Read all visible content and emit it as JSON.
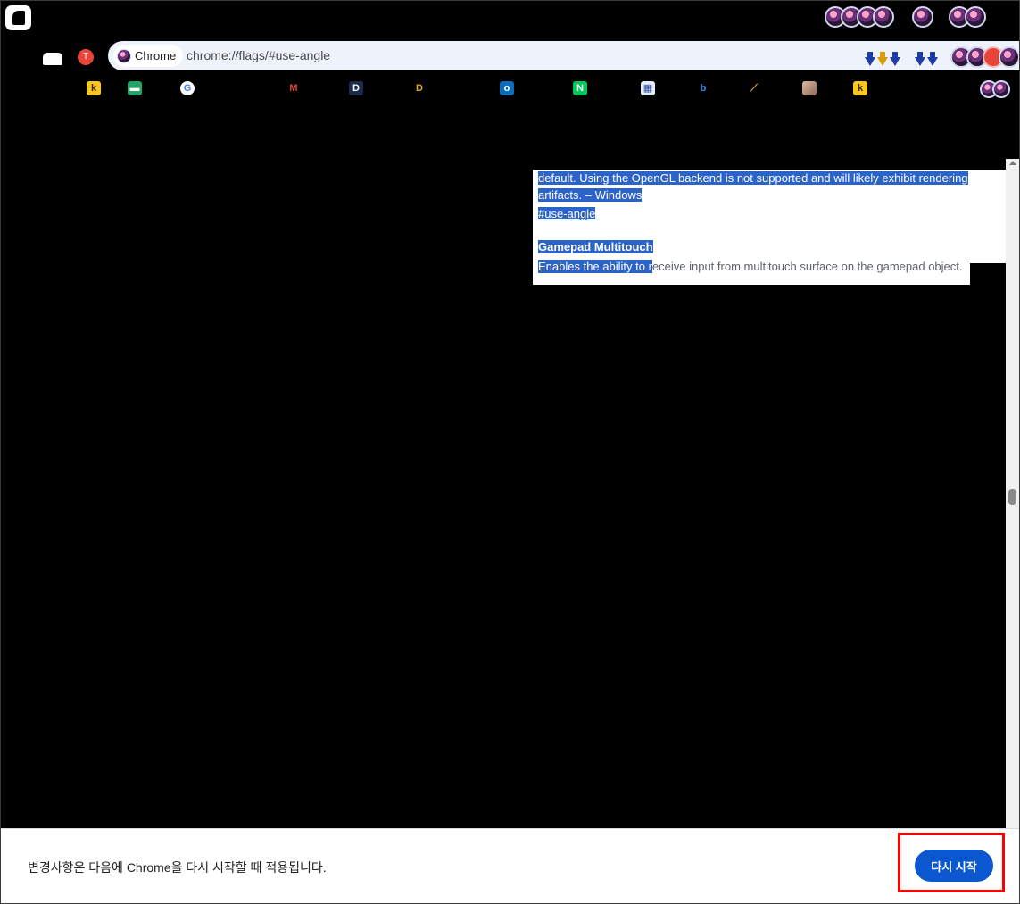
{
  "toolbar": {
    "site_chip": "Chrome",
    "url": "chrome://flags/#use-angle",
    "tab_badge": "T"
  },
  "bookmarks": {
    "k1": "k",
    "sheet": "▬",
    "google": "G",
    "gmail": "M",
    "d1": "D",
    "d2": "D",
    "outlook": "o",
    "naver": "N",
    "calendar": "▦",
    "bing": "b",
    "ads": "⟋",
    "k2": "k"
  },
  "flag_angle": {
    "description_line1": "default. Using the OpenGL backend is not supported and will likely exhibit rendering",
    "description_line2": "artifacts. – Windows",
    "anchor": "#use-angle"
  },
  "flag_gamepad": {
    "title": "Gamepad Multitouch",
    "description_selected": "Enables the ability to r",
    "description_rest": "eceive input from multitouch surface on the gamepad object."
  },
  "relaunch": {
    "message": "변경사항은 다음에 Chrome을 다시 시작할 때 적용됩니다.",
    "button_label": "다시 시작"
  },
  "colors": {
    "selection": "#2b63c8",
    "relaunch_button": "#0b57d0",
    "highlight_box": "#ff0000"
  }
}
